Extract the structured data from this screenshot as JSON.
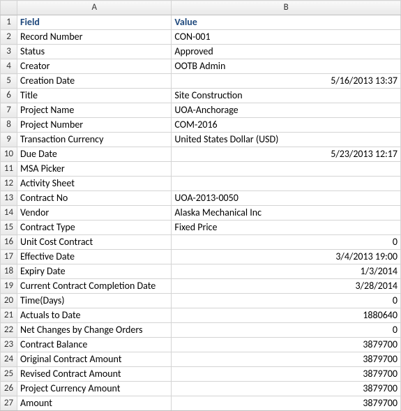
{
  "columns": {
    "A": "A",
    "B": "B"
  },
  "header": {
    "field": "Field",
    "value": "Value"
  },
  "rows": [
    {
      "n": "1"
    },
    {
      "n": "2",
      "field": "Record Number",
      "value": "CON-001",
      "align": "left"
    },
    {
      "n": "3",
      "field": "Status",
      "value": "Approved",
      "align": "left"
    },
    {
      "n": "4",
      "field": "Creator",
      "value": "OOTB Admin",
      "align": "left"
    },
    {
      "n": "5",
      "field": "Creation Date",
      "value": "5/16/2013 13:37",
      "align": "right"
    },
    {
      "n": "6",
      "field": "Title",
      "value": "Site Construction",
      "align": "left"
    },
    {
      "n": "7",
      "field": "Project Name",
      "value": "UOA-Anchorage",
      "align": "left"
    },
    {
      "n": "8",
      "field": "Project Number",
      "value": "COM-2016",
      "align": "left"
    },
    {
      "n": "9",
      "field": "Transaction Currency",
      "value": "United States Dollar (USD)",
      "align": "left"
    },
    {
      "n": "10",
      "field": "Due Date",
      "value": "5/23/2013 12:17",
      "align": "right"
    },
    {
      "n": "11",
      "field": "MSA Picker",
      "value": "",
      "align": "left"
    },
    {
      "n": "12",
      "field": "Activity Sheet",
      "value": "",
      "align": "left"
    },
    {
      "n": "13",
      "field": "Contract No",
      "value": "UOA-2013-0050",
      "align": "left"
    },
    {
      "n": "14",
      "field": "Vendor",
      "value": "Alaska Mechanical Inc",
      "align": "left"
    },
    {
      "n": "15",
      "field": "Contract Type",
      "value": "Fixed Price",
      "align": "left"
    },
    {
      "n": "16",
      "field": "Unit Cost Contract",
      "value": "0",
      "align": "right"
    },
    {
      "n": "17",
      "field": "Effective Date",
      "value": "3/4/2013 19:00",
      "align": "right"
    },
    {
      "n": "18",
      "field": "Expiry Date",
      "value": "1/3/2014",
      "align": "right"
    },
    {
      "n": "19",
      "field": "Current Contract Completion Date",
      "value": "3/28/2014",
      "align": "right"
    },
    {
      "n": "20",
      "field": "Time(Days)",
      "value": "0",
      "align": "right"
    },
    {
      "n": "21",
      "field": "Actuals to Date",
      "value": "1880640",
      "align": "right"
    },
    {
      "n": "22",
      "field": "Net Changes by Change Orders",
      "value": "0",
      "align": "right"
    },
    {
      "n": "23",
      "field": "Contract Balance",
      "value": "3879700",
      "align": "right"
    },
    {
      "n": "24",
      "field": "Original Contract Amount",
      "value": "3879700",
      "align": "right"
    },
    {
      "n": "25",
      "field": "Revised Contract Amount",
      "value": "3879700",
      "align": "right"
    },
    {
      "n": "26",
      "field": "Project Currency Amount",
      "value": "3879700",
      "align": "right"
    },
    {
      "n": "27",
      "field": "Amount",
      "value": "3879700",
      "align": "right"
    }
  ]
}
